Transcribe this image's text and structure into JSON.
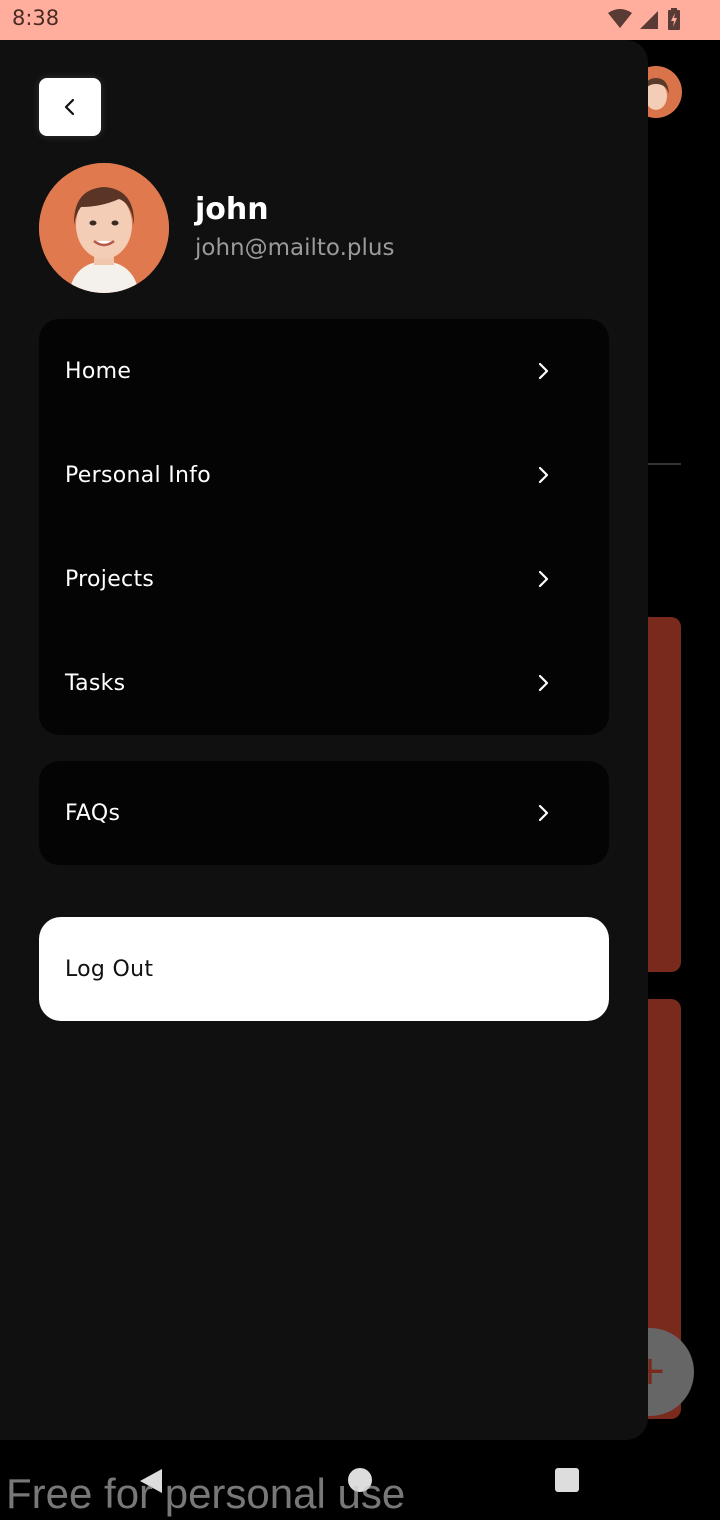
{
  "status_bar": {
    "time": "8:38",
    "icons": [
      "wifi-icon",
      "cell-signal-icon",
      "battery-charging-icon"
    ]
  },
  "drawer": {
    "back_icon": "chevron-left-icon",
    "user": {
      "name": "john",
      "email": "john@mailto.plus"
    },
    "menu": [
      {
        "label": "Home",
        "icon": "chevron-right-icon"
      },
      {
        "label": "Personal Info",
        "icon": "chevron-right-icon"
      },
      {
        "label": "Projects",
        "icon": "chevron-right-icon"
      },
      {
        "label": "Tasks",
        "icon": "chevron-right-icon"
      }
    ],
    "secondary_menu": [
      {
        "label": "FAQs",
        "icon": "chevron-right-icon"
      }
    ],
    "logout_label": "Log Out"
  },
  "background_app": {
    "fab_icon": "plus-icon",
    "fab_symbol": "+"
  },
  "nav_bar": {
    "icons": [
      "back-triangle-icon",
      "home-circle-icon",
      "recents-square-icon"
    ]
  },
  "watermark": "Free for personal use",
  "colors": {
    "status_bar": "#ffae9d",
    "drawer_bg": "#101010",
    "card_bg": "#040404",
    "accent": "#e07a4e",
    "bg_card": "#7a2a1c"
  }
}
